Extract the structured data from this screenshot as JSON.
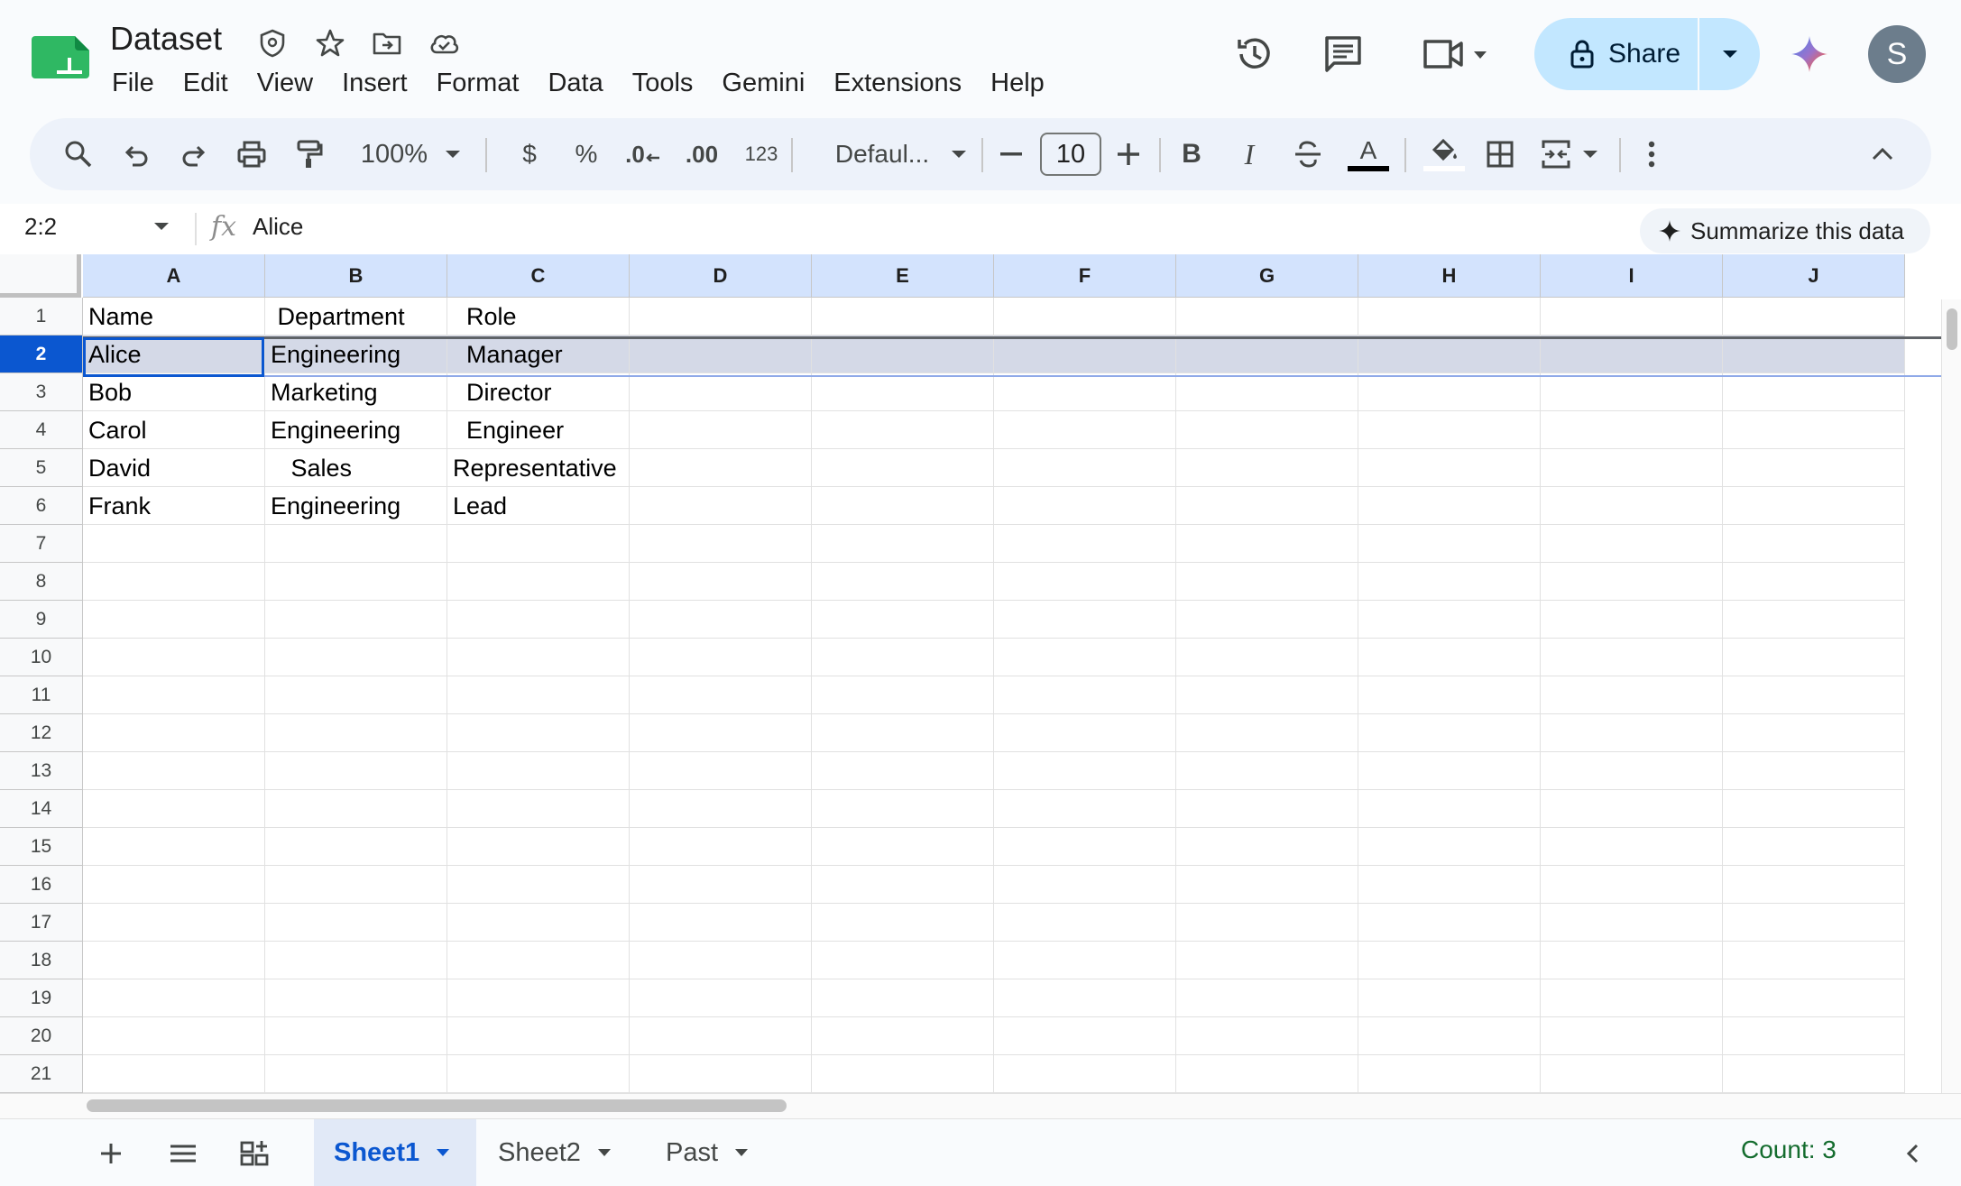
{
  "app": {
    "doc_title": "Dataset",
    "menu": [
      "File",
      "Edit",
      "View",
      "Insert",
      "Format",
      "Data",
      "Tools",
      "Gemini",
      "Extensions",
      "Help"
    ],
    "share_label": "Share",
    "avatar_initial": "S",
    "brand_color": "#0b57d0",
    "share_bg": "#c2e7ff"
  },
  "toolbar": {
    "zoom": "100%",
    "currency": "$",
    "percent": "%",
    "dec_decrease": ".0",
    "dec_increase": ".00",
    "number_format": "123",
    "font": "Defaul...",
    "font_size": "10",
    "bold": "B",
    "italic": "I",
    "text_color_letter": "A"
  },
  "formula_bar": {
    "name_box": "2:2",
    "fx": "fx",
    "value": "Alice",
    "summarize_label": "Summarize this data"
  },
  "grid": {
    "columns": [
      "A",
      "B",
      "C",
      "D",
      "E",
      "F",
      "G",
      "H",
      "I",
      "J"
    ],
    "row_numbers": [
      "1",
      "2",
      "3",
      "4",
      "5",
      "6",
      "7",
      "8",
      "9",
      "10",
      "11",
      "12",
      "13",
      "14",
      "15",
      "16",
      "17",
      "18",
      "19",
      "20",
      "21"
    ],
    "selected_row": "2",
    "rows": [
      [
        "Name",
        " Department",
        "  Role"
      ],
      [
        "Alice",
        "Engineering",
        "  Manager"
      ],
      [
        "Bob",
        "Marketing",
        "  Director"
      ],
      [
        "Carol",
        "Engineering",
        "  Engineer"
      ],
      [
        "David",
        "   Sales",
        "Representative"
      ],
      [
        "Frank",
        "Engineering",
        "Lead"
      ]
    ]
  },
  "sheets": {
    "tabs": [
      "Sheet1",
      "Sheet2",
      "Past"
    ],
    "active": "Sheet1",
    "count": "Count: 3"
  }
}
